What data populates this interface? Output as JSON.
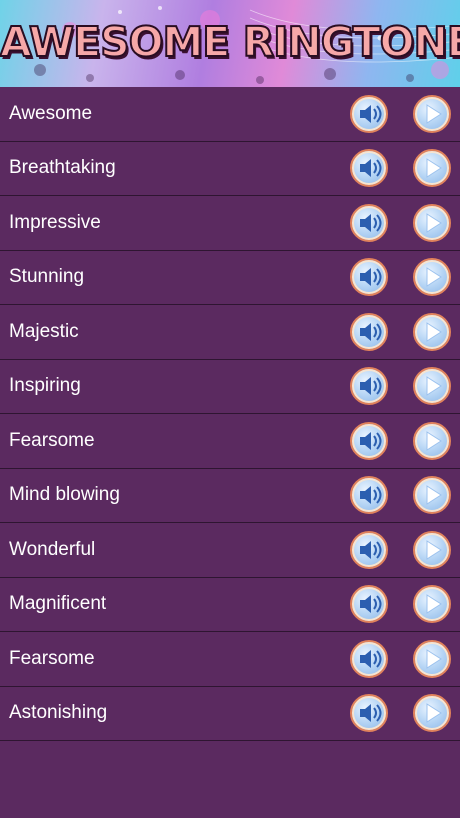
{
  "header": {
    "title": "AWESOME RINGTONES"
  },
  "colors": {
    "background": "#5b2a60",
    "divider": "#2e1531",
    "button_ring": "#e0825c",
    "button_fill": "#b8d6f5",
    "icon": "#2c5fb0",
    "title_fill": "#f6a8a8"
  },
  "ringtones": [
    {
      "label": "Awesome"
    },
    {
      "label": "Breathtaking"
    },
    {
      "label": "Impressive"
    },
    {
      "label": "Stunning"
    },
    {
      "label": "Majestic"
    },
    {
      "label": "Inspiring"
    },
    {
      "label": "Fearsome"
    },
    {
      "label": "Mind blowing"
    },
    {
      "label": "Wonderful"
    },
    {
      "label": "Magnificent"
    },
    {
      "label": "Fearsome"
    },
    {
      "label": "Astonishing"
    }
  ],
  "icons": {
    "sound": "speaker-icon",
    "play": "play-icon"
  }
}
